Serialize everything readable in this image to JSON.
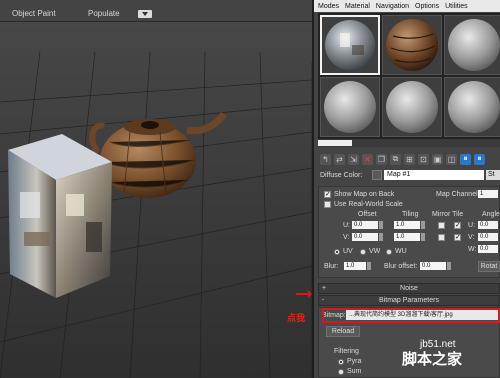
{
  "viewport": {
    "toolbar": {
      "object_paint": "Object Paint",
      "populate": "Populate"
    },
    "annotation": "点我"
  },
  "material_editor": {
    "menu": [
      "Modes",
      "Material",
      "Navigation",
      "Options",
      "Utilities"
    ],
    "diffuse": {
      "label": "Diffuse Color:",
      "map_name": "Map #1",
      "type_short": "St"
    },
    "coordinates": {
      "show_map_on_back": "Show Map on Back",
      "use_real_world_scale": "Use Real-World Scale",
      "map_channel_label": "Map Channel:",
      "map_channel_value": "1",
      "offset": "Offset",
      "tiling": "Tiling",
      "mirror_tile": "Mirror Tile",
      "angle": "Angle",
      "u_label": "U:",
      "v_label": "V:",
      "w_label": "W:",
      "u_offset": "0.0",
      "v_offset": "0.0",
      "u_tiling": "1.0",
      "v_tiling": "1.0",
      "u_angle": "0.0",
      "v_angle": "0.0",
      "w_angle": "0.0",
      "uv": "UV",
      "vw": "VW",
      "wu": "WU",
      "blur_label": "Blur:",
      "blur_value": "1.0",
      "blur_offset_label": "Blur offset:",
      "blur_offset_value": "0.0",
      "rotate_label": "Rotat"
    },
    "noise_header": "Noise",
    "bitmap_header": "Bitmap Parameters",
    "bitmap": {
      "label": "Bitmap:",
      "path": "...典现代简约模型 3D溜溜下载\\客厅.jpg"
    },
    "reload": "Reload",
    "filtering": "Filtering",
    "filter_opt1": "Pyra",
    "filter_opt2": "Sum"
  },
  "watermark": {
    "text": "脚本之家",
    "url": "jb51.net"
  }
}
